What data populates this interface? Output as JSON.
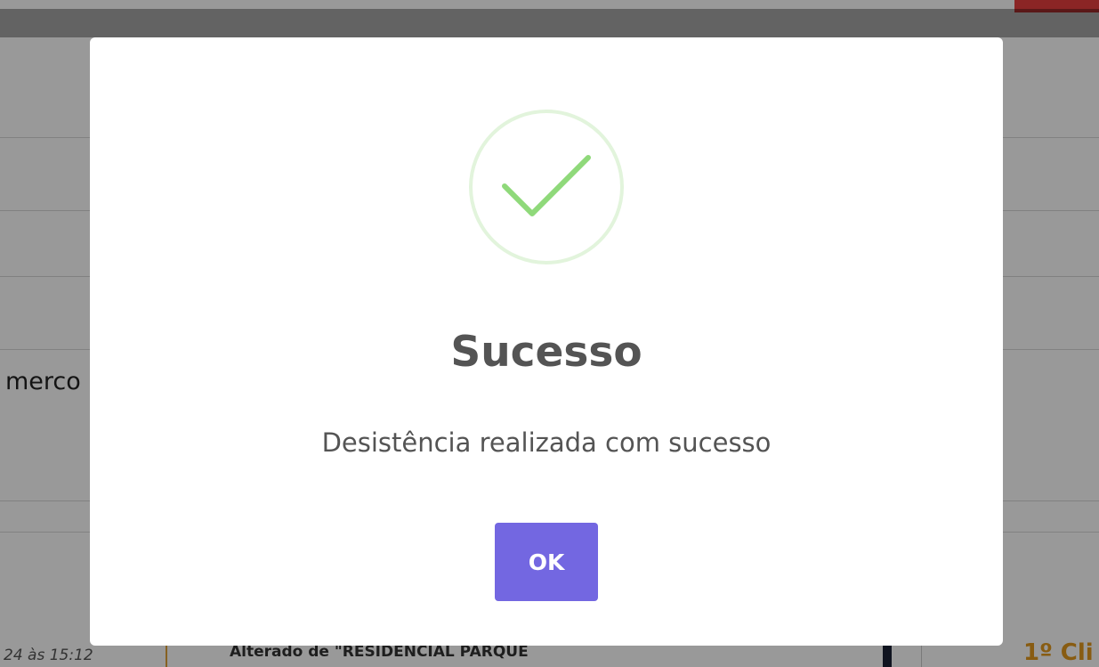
{
  "background": {
    "side_text": "merco",
    "date_text": "24 às 15:12",
    "history_text": "Alterado de \"RESIDENCIAL PARQUE",
    "right_label": "1º Cli"
  },
  "modal": {
    "icon": "success-check-icon",
    "title": "Sucesso",
    "message": "Desistência realizada com sucesso",
    "ok_label": "OK"
  },
  "colors": {
    "accent": "#7367e1",
    "success": "#8fd97a",
    "success_ring": "#e2f4dc",
    "text": "#545454",
    "top_accent": "#e83e3e",
    "right_label": "#e39a1f"
  }
}
